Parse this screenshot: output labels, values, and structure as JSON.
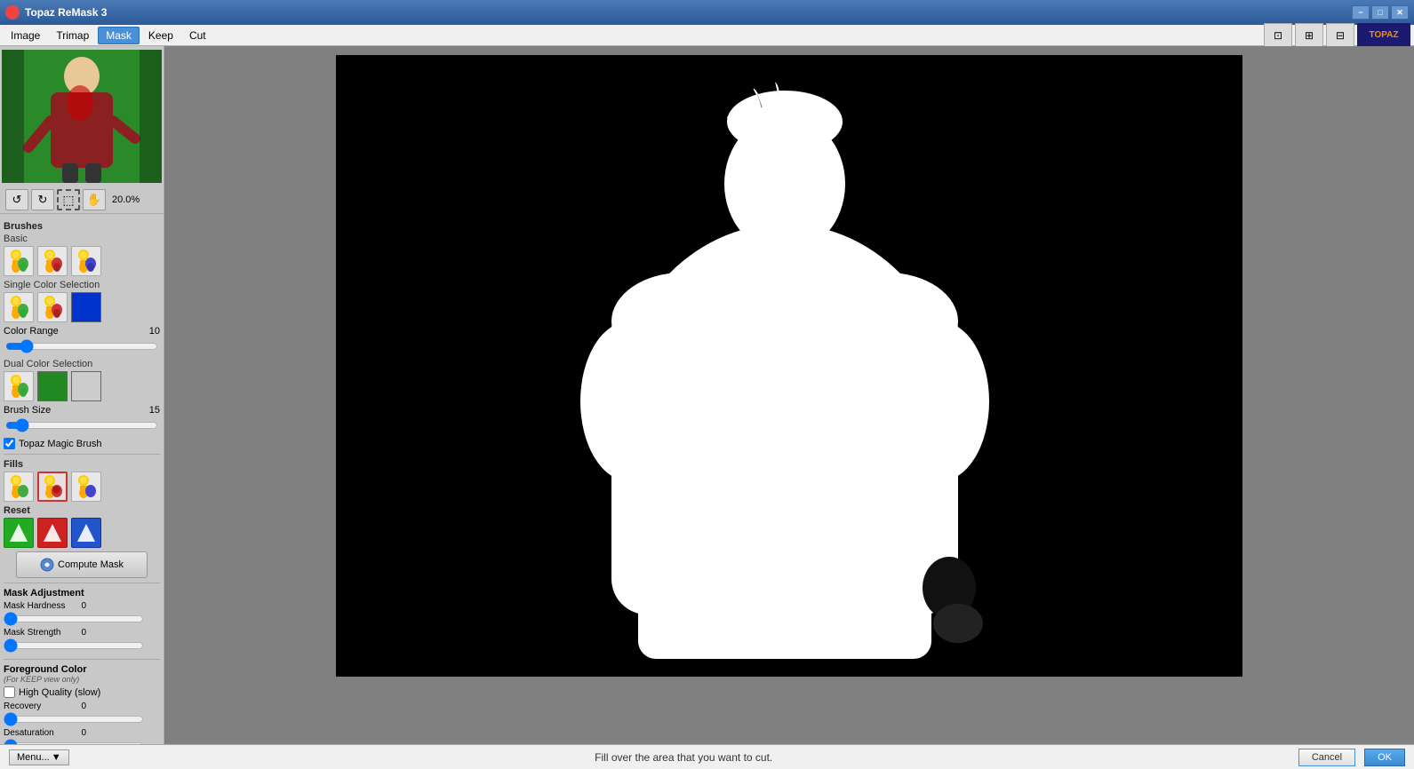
{
  "titleBar": {
    "title": "Topaz ReMask 3",
    "minBtn": "−",
    "maxBtn": "□",
    "closeBtn": "✕"
  },
  "menuBar": {
    "items": [
      {
        "id": "image",
        "label": "Image",
        "active": false
      },
      {
        "id": "trimap",
        "label": "Trimap",
        "active": false
      },
      {
        "id": "mask",
        "label": "Mask",
        "active": true
      },
      {
        "id": "keep",
        "label": "Keep",
        "active": false
      },
      {
        "id": "cut",
        "label": "Cut",
        "active": false
      }
    ]
  },
  "topIcons": {
    "icon1": "⊡",
    "icon2": "⊞",
    "icon3": "⊟",
    "logo": "TOPAZ"
  },
  "toolbar": {
    "undoBtn": "↺",
    "redoBtn": "↻",
    "selectBtn": "⬚",
    "handBtn": "✋",
    "zoomLevel": "20.0%"
  },
  "brushes": {
    "sectionLabel": "Brushes",
    "basicLabel": "Basic",
    "basicBrushes": [
      {
        "id": "keep-brush",
        "icon": "🖌",
        "color": "green"
      },
      {
        "id": "cut-brush",
        "icon": "🖌",
        "color": "red"
      },
      {
        "id": "unknown-brush",
        "icon": "🖌",
        "color": "blue"
      }
    ],
    "singleColorLabel": "Single Color Selection",
    "singleColorBrushes": [
      {
        "id": "sc-keep",
        "icon": "🖌",
        "color": "green"
      },
      {
        "id": "sc-cut",
        "icon": "🖌",
        "color": "red"
      }
    ],
    "colorSwatch": "blue",
    "colorRangeLabel": "Color Range",
    "colorRangeValue": 10,
    "dualColorLabel": "Dual Color Selection",
    "dualColorBrushes": [
      {
        "id": "dc-brush",
        "icon": "🖌",
        "color": "green"
      }
    ],
    "dualSwatch1": "green",
    "dualSwatch2": "lightgray",
    "brushSizeLabel": "Brush Size",
    "brushSizeValue": 15,
    "magicBrushLabel": "Topaz Magic Brush",
    "magicBrushChecked": true
  },
  "fills": {
    "sectionLabel": "Fills",
    "fillBtns": [
      {
        "id": "fill-keep",
        "icon": "🔵"
      },
      {
        "id": "fill-cut",
        "icon": "🔴"
      },
      {
        "id": "fill-unknown",
        "icon": "🔷"
      }
    ]
  },
  "reset": {
    "sectionLabel": "Reset",
    "resetBtns": [
      {
        "id": "reset-green",
        "color": "#22aa22"
      },
      {
        "id": "reset-red",
        "color": "#cc2222"
      },
      {
        "id": "reset-blue",
        "color": "#2255cc"
      }
    ]
  },
  "computeMask": {
    "label": "Compute Mask"
  },
  "maskAdjustment": {
    "sectionLabel": "Mask Adjustment",
    "hardnessLabel": "Mask Hardness",
    "hardnessValue": 0,
    "strengthLabel": "Mask Strength",
    "strengthValue": 0
  },
  "foregroundColor": {
    "sectionLabel": "Foreground Color",
    "subLabel": "(For KEEP view only)",
    "highQualityLabel": "High Quality (slow)",
    "highQualityChecked": false
  },
  "recovery": {
    "label": "Recovery",
    "value": 0
  },
  "desaturation": {
    "label": "Desaturation",
    "value": 0
  },
  "statusBar": {
    "menuBtn": "Menu...",
    "menuArrow": "▼",
    "message": "Fill over the area that you want to cut.",
    "cancelBtn": "Cancel",
    "okBtn": "OK"
  }
}
